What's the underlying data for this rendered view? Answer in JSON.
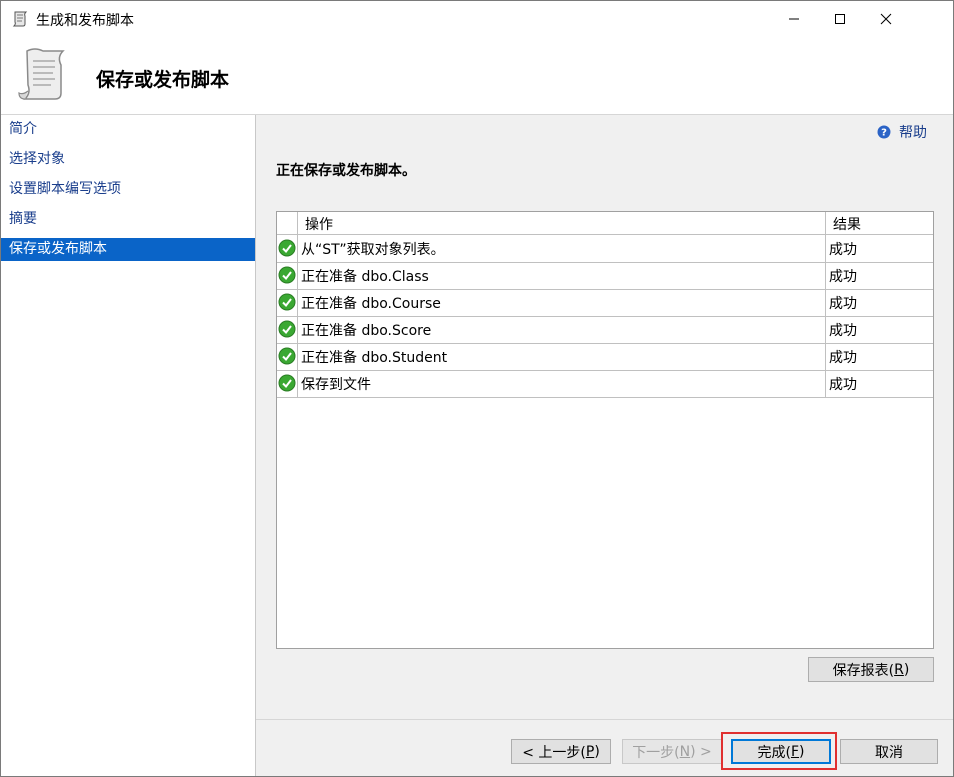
{
  "window": {
    "title": "生成和发布脚本",
    "icon": "script-scroll-icon"
  },
  "header": {
    "title": "保存或发布脚本",
    "icon": "script-scroll-icon"
  },
  "sidebar": {
    "items": [
      {
        "label": "简介",
        "active": false
      },
      {
        "label": "选择对象",
        "active": false
      },
      {
        "label": "设置脚本编写选项",
        "active": false
      },
      {
        "label": "摘要",
        "active": false
      },
      {
        "label": "保存或发布脚本",
        "active": true
      }
    ]
  },
  "main": {
    "help_label": "帮助",
    "status_text": "正在保存或发布脚本。",
    "table": {
      "columns": [
        "操作",
        "结果"
      ],
      "rows": [
        {
          "operation": "从“ST”获取对象列表。",
          "result": "成功",
          "status_icon": "success-check-icon"
        },
        {
          "operation": "正在准备 dbo.Class",
          "result": "成功",
          "status_icon": "success-check-icon"
        },
        {
          "operation": "正在准备 dbo.Course",
          "result": "成功",
          "status_icon": "success-check-icon"
        },
        {
          "operation": "正在准备 dbo.Score",
          "result": "成功",
          "status_icon": "success-check-icon"
        },
        {
          "operation": "正在准备 dbo.Student",
          "result": "成功",
          "status_icon": "success-check-icon"
        },
        {
          "operation": "保存到文件",
          "result": "成功",
          "status_icon": "success-check-icon"
        }
      ]
    },
    "save_report_label": "保存报表(",
    "save_report_key": "R",
    "save_report_end": ")"
  },
  "footer": {
    "prev_label": "< 上一步(",
    "prev_key": "P",
    "prev_end": ")",
    "next_label": "下一步(",
    "next_key": "N",
    "next_end": ") >",
    "finish_label": "完成(",
    "finish_key": "F",
    "finish_end": ")",
    "cancel_label": "取消"
  },
  "colors": {
    "selection": "#0a64c8",
    "link": "#1a3e8c",
    "success": "#3aa832",
    "highlight": "#e03030"
  }
}
